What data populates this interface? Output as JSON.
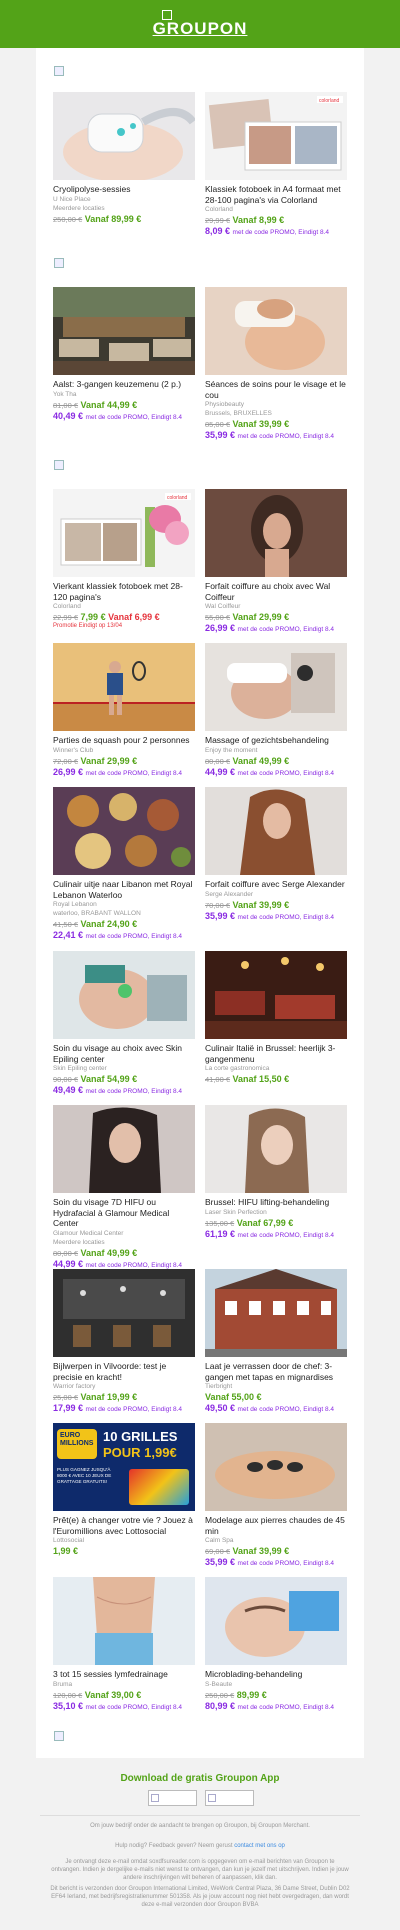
{
  "header": {
    "logo_text": "GROUPON"
  },
  "deals": [
    {
      "title": "Cryolipolyse-sessies",
      "merchant": "U Nice Place",
      "merchant2": "Meerdere locaties",
      "old": "250,00 €",
      "new": "Vanaf 89,99 €",
      "promo_price": "",
      "promo_text": ""
    },
    {
      "title": "Klassiek fotoboek in A4 formaat met 28-100 pagina's via Colorland",
      "merchant": "Colorland",
      "merchant2": "",
      "old": "29,99 €",
      "new": "Vanaf 8,99 €",
      "promo_price": "8,09 €",
      "promo_text": "met de code PROMO, Eindigt 8.4"
    },
    {
      "title": "Aalst: 3-gangen keuzemenu (2 p.)",
      "merchant": "Yok Tha",
      "merchant2": "",
      "old": "81,00 €",
      "new": "Vanaf 44,99 €",
      "promo_price": "40,49 €",
      "promo_text": "met de code PROMO, Eindigt 8.4"
    },
    {
      "title": "Séances de soins pour le visage et le cou",
      "merchant": "Physiobeauty",
      "merchant2": "Brussels, BRUXELLES",
      "old": "85,00 €",
      "new": "Vanaf 39,99 €",
      "promo_price": "35,99 €",
      "promo_text": "met de code PROMO, Eindigt 8.4"
    },
    {
      "title": "Vierkant klassiek fotoboek met 28-120 pagina's",
      "merchant": "Colorland",
      "merchant2": "",
      "old": "22,99 €",
      "new": "7,99 €",
      "red": "Vanaf 6,99 €",
      "red_note": "Promotie Eindigt op 13/04",
      "promo_price": "",
      "promo_text": ""
    },
    {
      "title": "Forfait coiffure au choix avec Wal Coiffeur",
      "merchant": "Wal Coiffeur",
      "merchant2": "",
      "old": "55,00 €",
      "new": "Vanaf 29,99 €",
      "promo_price": "26,99 €",
      "promo_text": "met de code PROMO, Eindigt 8.4"
    },
    {
      "title": "Parties de squash pour 2 personnes",
      "merchant": "Winner's Club",
      "merchant2": "",
      "old": "72,00 €",
      "new": "Vanaf 29,99 €",
      "promo_price": "26,99 €",
      "promo_text": "met de code PROMO, Eindigt 8.4"
    },
    {
      "title": "Massage of gezichtsbehandeling",
      "merchant": "Enjoy the moment",
      "merchant2": "",
      "old": "80,00 €",
      "new": "Vanaf 49,99 €",
      "promo_price": "44,99 €",
      "promo_text": "met de code PROMO, Eindigt 8.4"
    },
    {
      "title": "Culinair uitje naar Libanon met Royal Lebanon Waterloo",
      "merchant": "Royal Lebanon",
      "merchant2": "waterloo, BRABANT WALLON",
      "old": "41,50 €",
      "new": "Vanaf 24,90 €",
      "promo_price": "22,41 €",
      "promo_text": "met de code PROMO, Eindigt 8.4"
    },
    {
      "title": "Forfait coiffure avec Serge Alexander",
      "merchant": "Serge Alexander",
      "merchant2": "",
      "old": "70,00 €",
      "new": "Vanaf 39,99 €",
      "promo_price": "35,99 €",
      "promo_text": "met de code PROMO, Eindigt 8.4"
    },
    {
      "title": "Soin du visage au choix avec Skin Epiling center",
      "merchant": "Skin Epiling center",
      "merchant2": "",
      "old": "90,00 €",
      "new": "Vanaf 54,99 €",
      "promo_price": "49,49 €",
      "promo_text": "met de code PROMO, Eindigt 8.4"
    },
    {
      "title": "Culinair Italië in Brussel: heerlijk 3-gangenmenu",
      "merchant": "La corte gastronomica",
      "merchant2": "",
      "old": "41,00 €",
      "new": "Vanaf 15,50 €",
      "promo_price": "",
      "promo_text": ""
    },
    {
      "title": "Soin du visage 7D HIFU ou Hydrafacial à Glamour Medical Center",
      "merchant": "Glamour Medical Center",
      "merchant2": "Meerdere locaties",
      "old": "80,00 €",
      "new": "Vanaf 49,99 €",
      "promo_price": "44,99 €",
      "promo_text": "met de code PROMO, Eindigt 8.4"
    },
    {
      "title": "Brussel: HIFU lifting-behandeling",
      "merchant": "Laser Skin Perfection",
      "merchant2": "",
      "old": "135,00 €",
      "new": "Vanaf 67,99 €",
      "promo_price": "61,19 €",
      "promo_text": "met de code PROMO, Eindigt 8.4"
    },
    {
      "title": "Bijlwerpen in Vilvoorde: test je precisie en kracht!",
      "merchant": "Warrior factory",
      "merchant2": "",
      "old": "25,00 €",
      "new": "Vanaf 19,99 €",
      "promo_price": "17,99 €",
      "promo_text": "met de code PROMO, Eindigt 8.4"
    },
    {
      "title": "Laat je verrassen door de chef: 3-gangen met tapas en mignardises",
      "merchant": "Tierbright",
      "merchant2": "",
      "old": "",
      "new": "Vanaf 55,00 €",
      "promo_price": "49,50 €",
      "promo_text": "met de code PROMO, Eindigt 8.4"
    },
    {
      "title": "Prêt(e) à changer votre vie ? Jouez à l'Euromillions avec Lottosocial",
      "merchant": "Lottosocial",
      "merchant2": "",
      "old": "",
      "new": "1,99 €",
      "promo_price": "",
      "promo_text": "",
      "banner_line1": "10 GRILLES",
      "banner_line2": "POUR 1,99€",
      "banner_sub": "PLUS GAGNEZ JUSQU'À 8000 € AVEC 10 JEUX DE GRATTAGE GRATUITS!",
      "banner_brand": "EURO MILLIONS"
    },
    {
      "title": "Modelage aux pierres chaudes de 45 min",
      "merchant": "Calm Spa",
      "merchant2": "",
      "old": "69,00 €",
      "new": "Vanaf 39,99 €",
      "promo_price": "35,99 €",
      "promo_text": "met de code PROMO, Eindigt 8.4"
    },
    {
      "title": "3 tot 15 sessies lymfedrainage",
      "merchant": "Bruma",
      "merchant2": "",
      "old": "120,00 €",
      "new": "Vanaf 39,00 €",
      "promo_price": "35,10 €",
      "promo_text": "met de code PROMO, Eindigt 8.4"
    },
    {
      "title": "Microblading-behandeling",
      "merchant": "S-Beaute",
      "merchant2": "",
      "old": "250,00 €",
      "new": "89,99 €",
      "promo_price": "80,99 €",
      "promo_text": "met de code PROMO, Eindigt 8.4"
    }
  ],
  "thumb_brand": "colorland",
  "footer": {
    "app_title": "Download de gratis Groupon App",
    "line1": "Om jouw bedrijf onder de aandacht te brengen op Groupon, bij Groupon Merchant.",
    "help_prefix": "Hulp nodig? Feedback geven? Neem gerust",
    "help_link": "contact met ons op",
    "line3": "Je ontvangt deze e-mail omdat soxdfsureader.com is opgegeven om e-mail berichten van Groupon te ontvangen. Indien je dergelijke e-mails niet wenst te ontvangen, dan kun je jezelf met uitschrijven. Indien je jouw andere inschrijvingen wilt beheren of aanpassen, klik dan.",
    "line4": "Dit bericht is verzonden door Groupon International Limited, WeWork Central Plaza, 36 Dame Street, Dublin D02 EF64 Ierland, met bedrijfsregistratienummer 501358. Als je jouw account nog niet hebt overgedragen, dan wordt deze e-mail verzonden door Groupon BVBA"
  }
}
